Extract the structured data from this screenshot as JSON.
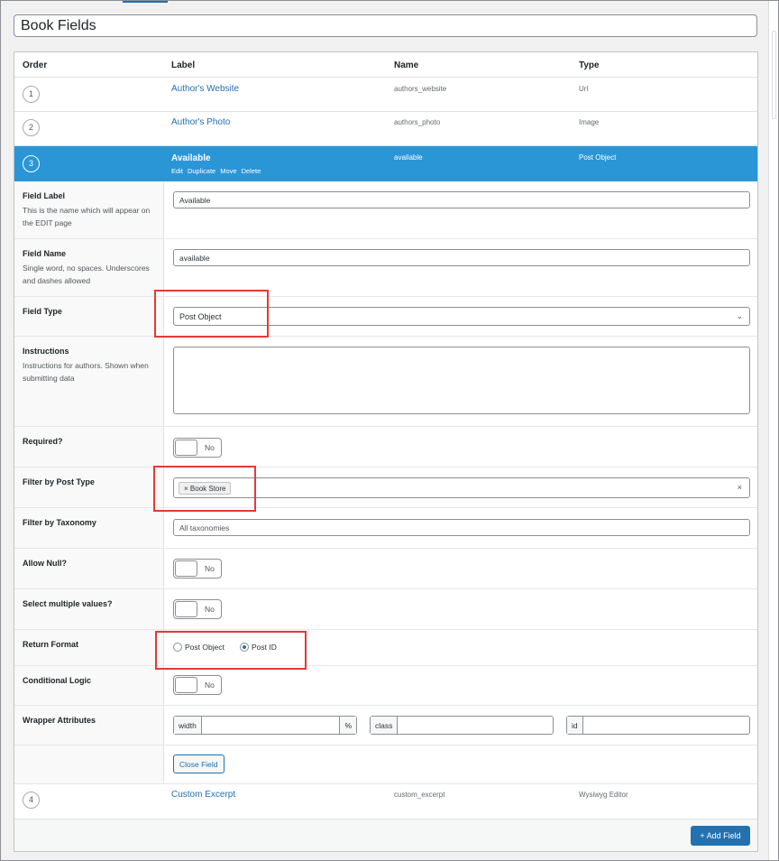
{
  "group_title": "Book Fields",
  "table_header": {
    "order": "Order",
    "label": "Label",
    "name": "Name",
    "type": "Type"
  },
  "fields": [
    {
      "order": "1",
      "label": "Author's Website",
      "name": "authors_website",
      "type": "Url"
    },
    {
      "order": "2",
      "label": "Author's Photo",
      "name": "authors_photo",
      "type": "Image"
    },
    {
      "order": "3",
      "label": "Available",
      "name": "available",
      "type": "Post Object"
    },
    {
      "order": "4",
      "label": "Custom Excerpt",
      "name": "custom_excerpt",
      "type": "Wysiwyg Editor"
    }
  ],
  "row_actions": {
    "edit": "Edit",
    "duplicate": "Duplicate",
    "move": "Move",
    "delete": "Delete"
  },
  "settings": {
    "field_label": {
      "title": "Field Label",
      "desc": "This is the name which will appear on the EDIT page",
      "value": "Available"
    },
    "field_name": {
      "title": "Field Name",
      "desc": "Single word, no spaces. Underscores and dashes allowed",
      "value": "available"
    },
    "field_type": {
      "title": "Field Type",
      "value": "Post Object"
    },
    "instructions": {
      "title": "Instructions",
      "desc": "Instructions for authors. Shown when submitting data",
      "value": ""
    },
    "required": {
      "title": "Required?",
      "toggle": "No"
    },
    "filter_post_type": {
      "title": "Filter by Post Type",
      "chip": "Book Store",
      "chip_remove": "×",
      "clear": "×"
    },
    "filter_taxonomy": {
      "title": "Filter by Taxonomy",
      "placeholder": "All taxonomies"
    },
    "allow_null": {
      "title": "Allow Null?",
      "toggle": "No"
    },
    "multiple": {
      "title": "Select multiple values?",
      "toggle": "No"
    },
    "return_format": {
      "title": "Return Format",
      "option_object": "Post Object",
      "option_id": "Post ID",
      "selected": "Post ID"
    },
    "conditional": {
      "title": "Conditional Logic",
      "toggle": "No"
    },
    "wrapper": {
      "title": "Wrapper Attributes",
      "width_label": "width",
      "width_unit": "%",
      "class_label": "class",
      "id_label": "id"
    },
    "close_button": "Close Field"
  },
  "add_button": "+ Add Field",
  "colors": {
    "accent": "#2271b1",
    "active_row": "#2a96d6",
    "highlight": "#e53935"
  }
}
